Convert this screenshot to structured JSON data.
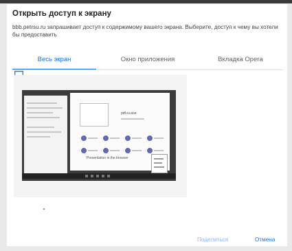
{
  "dialog": {
    "title": "Открыть доступ к экрану",
    "description": "bbb.petrsu.ru запрашивает доступ к содержимому вашего экрана. Выберите, доступ к чему вы хотели бы предоставить",
    "tabs": [
      {
        "label": "Весь экран",
        "active": true
      },
      {
        "label": "Окно приложения",
        "active": false
      },
      {
        "label": "Вкладка Opera",
        "active": false
      }
    ],
    "preview": {
      "title_text": "pdf.ru.aoe",
      "caption": "Presentation in the browser"
    },
    "buttons": {
      "share": "Поделиться",
      "cancel": "Отмена"
    }
  },
  "colors": {
    "accent": "#1a73e8",
    "accent_disabled": "#8ab4f8",
    "thumb_background": "#3b3b3b",
    "dot": "#5f6bad"
  },
  "icons": {
    "screen": "monitor-icon"
  }
}
